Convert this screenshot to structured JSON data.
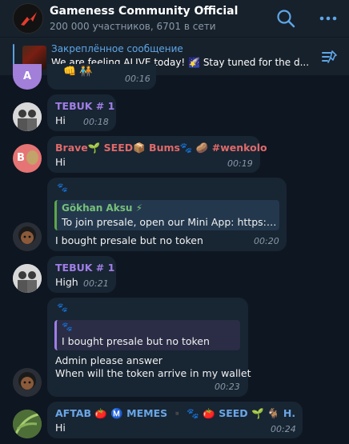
{
  "header": {
    "title": "Gameness Community Official",
    "subtitle": "200 000 участников, 6701 в сети"
  },
  "pinned": {
    "label": "Закреплённое сообщение",
    "text": "We are feeling ALIVE today! 🌠   Stay tuned for the d..."
  },
  "colors": {
    "background": "#0e1621",
    "header": "#17212b",
    "bubble": "#182533",
    "accent": "#5ea6e8",
    "name_purple": "#a07ee6",
    "name_red": "#e06a6a",
    "name_green": "#77c07a",
    "name_blue": "#6aa6e6"
  },
  "icons": {
    "search": "search-icon",
    "more": "more-dots-icon",
    "pinned_list": "pinned-list-icon"
  },
  "messages": [
    {
      "avatar_letter": "A",
      "time": "00:16"
    },
    {
      "sender": "TEBUK # 1",
      "text": "Hi",
      "time": "00:18"
    },
    {
      "avatar_letter": "B",
      "sender": "Brave🌱 SEED📦 Bums🐾 🥔 #wenkolo",
      "text": "Hi",
      "time": "00:19"
    },
    {
      "reply_name": "Gökhan Aksu ⚡",
      "reply_text": "To join presale, open our Mini App: https://...",
      "text": "I bought presale but no token",
      "time": "00:20"
    },
    {
      "sender": "TEBUK # 1",
      "text": "High",
      "time": "00:21"
    },
    {
      "reply_text": "I bought presale but no token",
      "text_line1": "Admin please answer",
      "text_line2": "When will the token arrive in my wallet",
      "time": "00:23"
    },
    {
      "sender": "AFTAB 🍅 Ⓜ️ MEMES ▪️ 🐾 🍅 SEED 🌱 🐐 H...",
      "text": "Hi",
      "time": "00:24"
    }
  ]
}
